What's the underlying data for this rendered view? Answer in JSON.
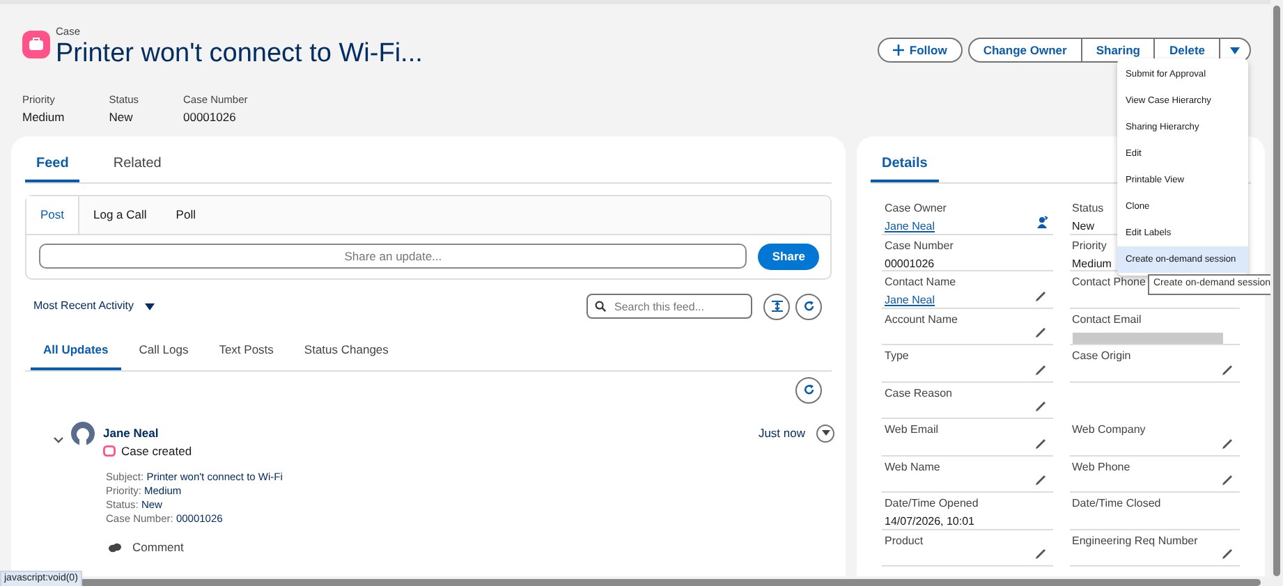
{
  "header": {
    "object_label": "Case",
    "title": "Printer won't connect to Wi-Fi...",
    "highlights": [
      {
        "label": "Priority",
        "value": "Medium"
      },
      {
        "label": "Status",
        "value": "New"
      },
      {
        "label": "Case Number",
        "value": "00001026"
      }
    ],
    "actions": [
      {
        "kind": "follow",
        "label": "Follow"
      },
      {
        "kind": "button",
        "label": "Change Owner"
      },
      {
        "kind": "button",
        "label": "Sharing"
      },
      {
        "kind": "button",
        "label": "Delete"
      },
      {
        "kind": "menu",
        "expanded": true
      }
    ]
  },
  "action_menu": {
    "items": [
      {
        "label": "Submit for Approval",
        "selected": false
      },
      {
        "label": "View Case Hierarchy",
        "selected": false
      },
      {
        "label": "Sharing Hierarchy",
        "selected": false
      },
      {
        "label": "Edit",
        "selected": false
      },
      {
        "label": "Printable View",
        "selected": false
      },
      {
        "label": "Clone",
        "selected": false
      },
      {
        "label": "Edit Labels",
        "selected": false
      },
      {
        "label": "Create on-demand session",
        "selected": true
      }
    ],
    "tooltip": "Create on-demand session"
  },
  "feed_panel": {
    "tabs": [
      {
        "label": "Feed",
        "selected": true
      },
      {
        "label": "Related",
        "selected": false
      }
    ],
    "publisher": {
      "tabs": [
        {
          "label": "Post",
          "selected": true
        },
        {
          "label": "Log a Call",
          "selected": false
        },
        {
          "label": "Poll",
          "selected": false
        }
      ],
      "placeholder": "Share an update...",
      "button": "Share"
    },
    "sort": "Most Recent Activity",
    "search": {
      "placeholder": "Search this feed..."
    },
    "filters": [
      {
        "label": "All Updates",
        "selected": true
      },
      {
        "label": "Call Logs",
        "selected": false
      },
      {
        "label": "Text Posts",
        "selected": false
      },
      {
        "label": "Status Changes",
        "selected": false
      }
    ],
    "items": [
      {
        "author": "Jane Neal",
        "action": "Case created",
        "time": "Just now",
        "expanded": true,
        "lines": [
          {
            "label": "Subject:",
            "value": "Printer won't connect to Wi-Fi"
          },
          {
            "label": "Priority:",
            "value": "Medium"
          },
          {
            "label": "Status:",
            "value": "New"
          },
          {
            "label": "Case Number:",
            "value": "00001026"
          }
        ],
        "comment": "Comment"
      }
    ]
  },
  "details_panel": {
    "tabs": [
      {
        "label": "Details",
        "selected": true
      }
    ],
    "rows": [
      {
        "left": {
          "label": "Case Owner",
          "value": "Jane Neal",
          "link": true,
          "change_owner": true
        },
        "right": {
          "label": "Status",
          "value": "New"
        }
      },
      {
        "left": {
          "label": "Case Number",
          "value": "00001026"
        },
        "right": {
          "label": "Priority",
          "value": "Medium"
        }
      },
      {
        "left": {
          "label": "Contact Name",
          "value": "Jane Neal",
          "link": true,
          "editable": true
        },
        "right": {
          "label": "Contact Phone"
        }
      },
      {
        "left": {
          "label": "Account Name",
          "editable": true
        },
        "right": {
          "label": "Contact Email",
          "redacted": true
        }
      },
      {
        "left": {
          "label": "Type",
          "editable": true
        },
        "right": {
          "label": "Case Origin",
          "editable": true
        }
      },
      {
        "left": {
          "label": "Case Reason",
          "editable": true
        }
      },
      {
        "left": {
          "label": "Web Email",
          "editable": true
        },
        "right": {
          "label": "Web Company",
          "editable": true
        }
      },
      {
        "left": {
          "label": "Web Name",
          "editable": true
        },
        "right": {
          "label": "Web Phone",
          "editable": true
        }
      },
      {
        "left": {
          "label": "Date/Time Opened",
          "value": "14/07/2026, 10:01"
        },
        "right": {
          "label": "Date/Time Closed"
        }
      },
      {
        "left": {
          "label": "Product",
          "editable": true
        },
        "right": {
          "label": "Engineering Req Number",
          "editable": true
        }
      }
    ]
  },
  "status_url": "javascript:void(0)"
}
